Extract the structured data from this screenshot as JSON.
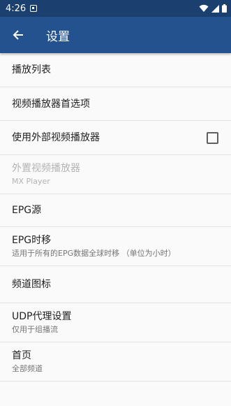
{
  "status_bar": {
    "time": "4:26",
    "icons": [
      "notification-icon",
      "wifi-icon",
      "cell-signal-icon",
      "battery-icon"
    ]
  },
  "app_bar": {
    "title": "设置",
    "back_icon": "back-arrow-icon"
  },
  "settings": [
    {
      "title": "播放列表"
    },
    {
      "title": "视频播放器首选项"
    },
    {
      "title": "使用外部视频播放器",
      "checkbox_checked": false
    },
    {
      "title": "外置视频播放器",
      "summary": "MX Player",
      "disabled": true
    },
    {
      "title": "EPG源"
    },
    {
      "title": "EPG时移",
      "summary": "适用于所有的EPG数据全球时移 （单位为小时）"
    },
    {
      "title": "频道图标"
    },
    {
      "title": "UDP代理设置",
      "summary": "仅用于组播流"
    },
    {
      "title": "首页",
      "summary": "全部频道"
    }
  ],
  "colors": {
    "status_bar": "#1b3f6e",
    "app_bar": "#24528f",
    "background": "#fafafa",
    "divider": "#e3e3e3"
  }
}
